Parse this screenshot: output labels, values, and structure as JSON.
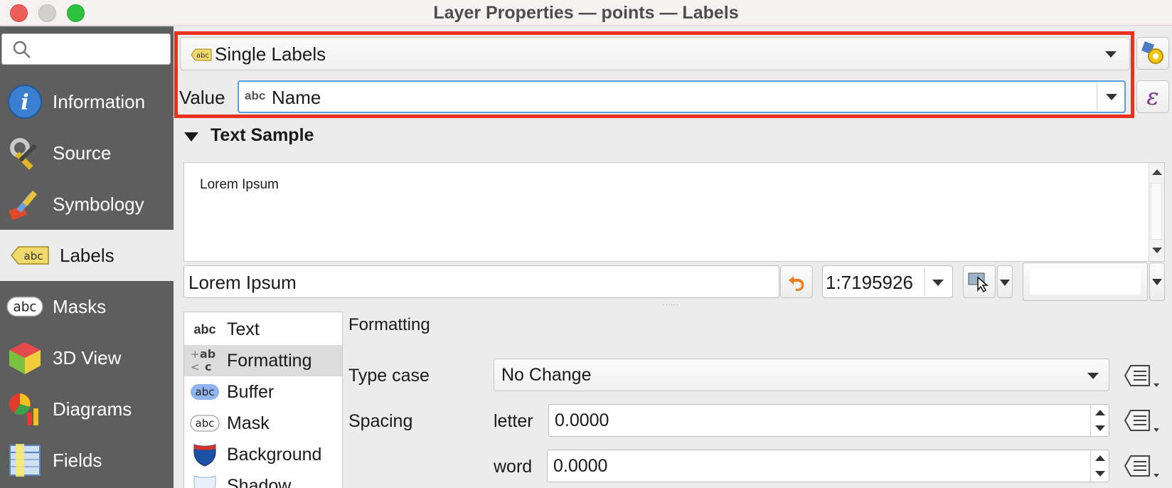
{
  "window": {
    "title": "Layer Properties — points — Labels"
  },
  "search": {
    "placeholder": ""
  },
  "sidebar": {
    "items": [
      {
        "label": "Information"
      },
      {
        "label": "Source"
      },
      {
        "label": "Symbology"
      },
      {
        "label": "Labels"
      },
      {
        "label": "Masks"
      },
      {
        "label": "3D View"
      },
      {
        "label": "Diagrams"
      },
      {
        "label": "Fields"
      }
    ]
  },
  "labeling": {
    "mode": "Single Labels",
    "mode_icon_text": "abc",
    "value_label": "Value",
    "value_type_icon": "abc",
    "value": "Name"
  },
  "text_sample": {
    "header": "Text Sample",
    "preview_text": "Lorem Ipsum",
    "sample_input": "Lorem Ipsum",
    "scale": "1:7195926",
    "background_color": "#ffffff",
    "splitter": "......"
  },
  "sections": {
    "items": [
      {
        "icon_text": "abc",
        "label": "Text"
      },
      {
        "icon_text": "ab c",
        "label": "Formatting"
      },
      {
        "icon_text": "abc",
        "label": "Buffer"
      },
      {
        "icon_text": "abc",
        "label": "Mask"
      },
      {
        "icon_text": "",
        "label": "Background"
      },
      {
        "icon_text": "",
        "label": "Shadow"
      }
    ]
  },
  "formatting": {
    "heading": "Formatting",
    "type_case_label": "Type case",
    "type_case_value": "No Change",
    "spacing_label": "Spacing",
    "letter_label": "letter",
    "letter_value": "0.0000",
    "word_label": "word",
    "word_value": "0.0000"
  },
  "colors": {
    "highlight": "#e8321f",
    "sidebar_bg": "#5e5e5e",
    "accent": "#3b82d6"
  }
}
